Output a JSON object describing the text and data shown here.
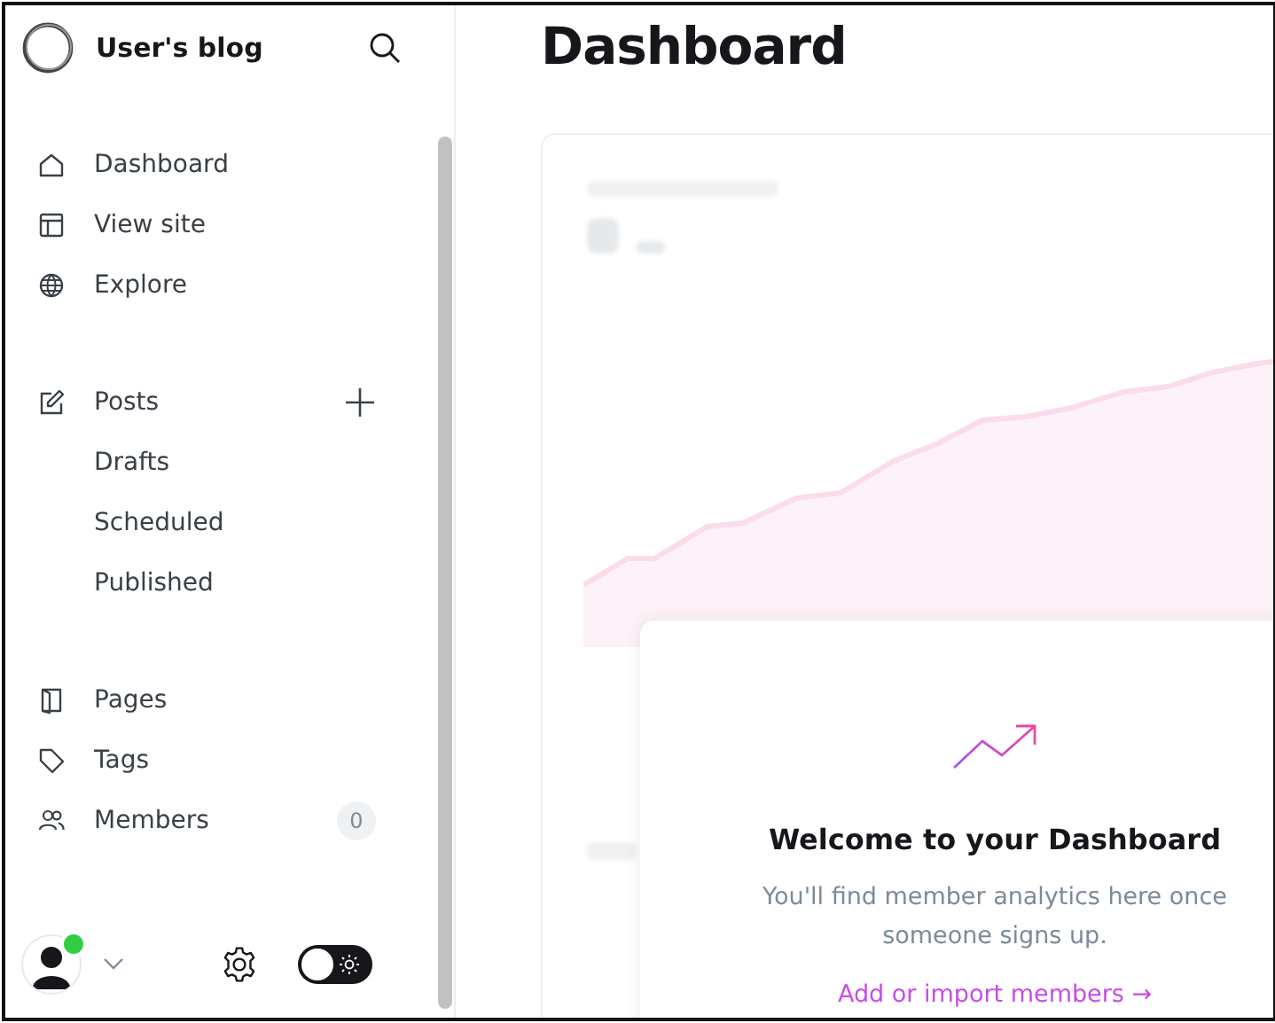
{
  "sidebar": {
    "blog_title": "User's blog",
    "nav_groups": [
      {
        "items": [
          {
            "label": "Dashboard"
          },
          {
            "label": "View site"
          },
          {
            "label": "Explore"
          }
        ]
      },
      {
        "items": [
          {
            "label": "Posts",
            "children": [
              {
                "label": "Drafts"
              },
              {
                "label": "Scheduled"
              },
              {
                "label": "Published"
              }
            ]
          }
        ]
      },
      {
        "items": [
          {
            "label": "Pages"
          },
          {
            "label": "Tags"
          },
          {
            "label": "Members",
            "count": "0"
          }
        ]
      }
    ],
    "footer": {
      "user_online": true,
      "dark_mode": {
        "on": false
      }
    }
  },
  "main": {
    "title": "Dashboard",
    "welcome": {
      "heading": "Welcome to your Dashboard",
      "text": "You'll find member analytics here once someone signs up.",
      "link": "Add or import members →"
    }
  }
}
